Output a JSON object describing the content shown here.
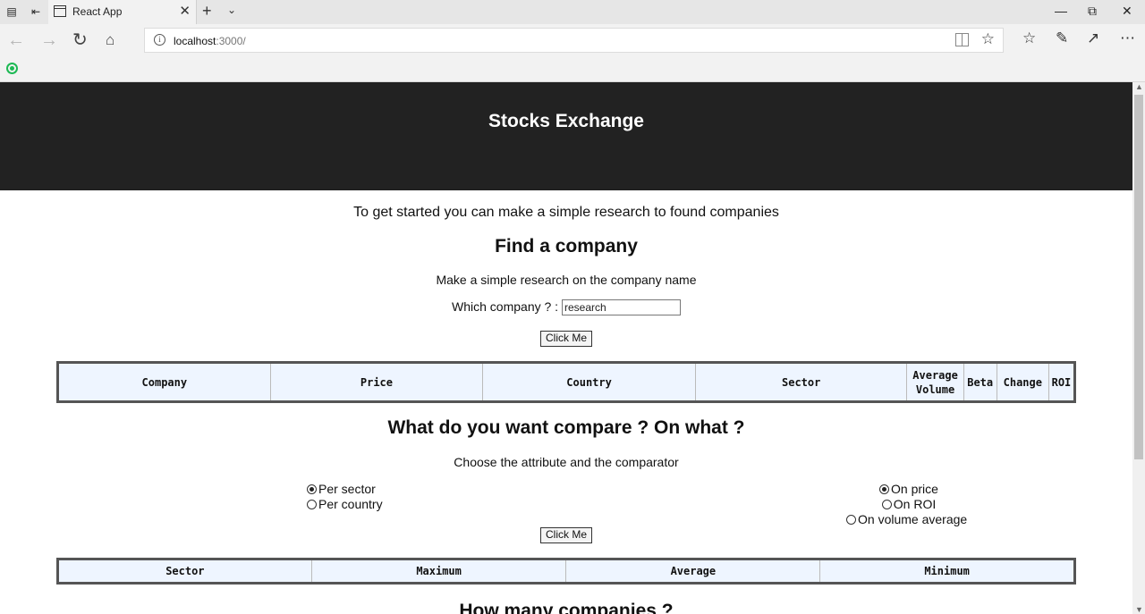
{
  "browser": {
    "tab_title": "React App",
    "url_host": "localhost",
    "url_path": ":3000/"
  },
  "page": {
    "header_title": "Stocks Exchange",
    "intro": "To get started you can make a simple research to found companies",
    "find": {
      "title": "Find a company",
      "subtitle": "Make a simple research on the company name",
      "label": "Which company ? :",
      "input_value": "research",
      "button": "Click Me"
    },
    "companies_table": {
      "columns": [
        "Company",
        "Price",
        "Country",
        "Sector",
        "Average Volume",
        "Beta",
        "Change",
        "ROI"
      ]
    },
    "compare": {
      "title": "What do you want compare ? On what ?",
      "subtitle": "Choose the attribute and the comparator",
      "attributes": [
        {
          "label": "Per sector",
          "checked": true
        },
        {
          "label": "Per country",
          "checked": false
        }
      ],
      "comparators": [
        {
          "label": "On price",
          "checked": true
        },
        {
          "label": "On ROI",
          "checked": false
        },
        {
          "label": "On volume average",
          "checked": false
        }
      ],
      "button": "Click Me"
    },
    "stats_table": {
      "columns": [
        "Sector",
        "Maximum",
        "Average",
        "Minimum"
      ]
    },
    "many": {
      "title": "How many companies ?"
    }
  }
}
